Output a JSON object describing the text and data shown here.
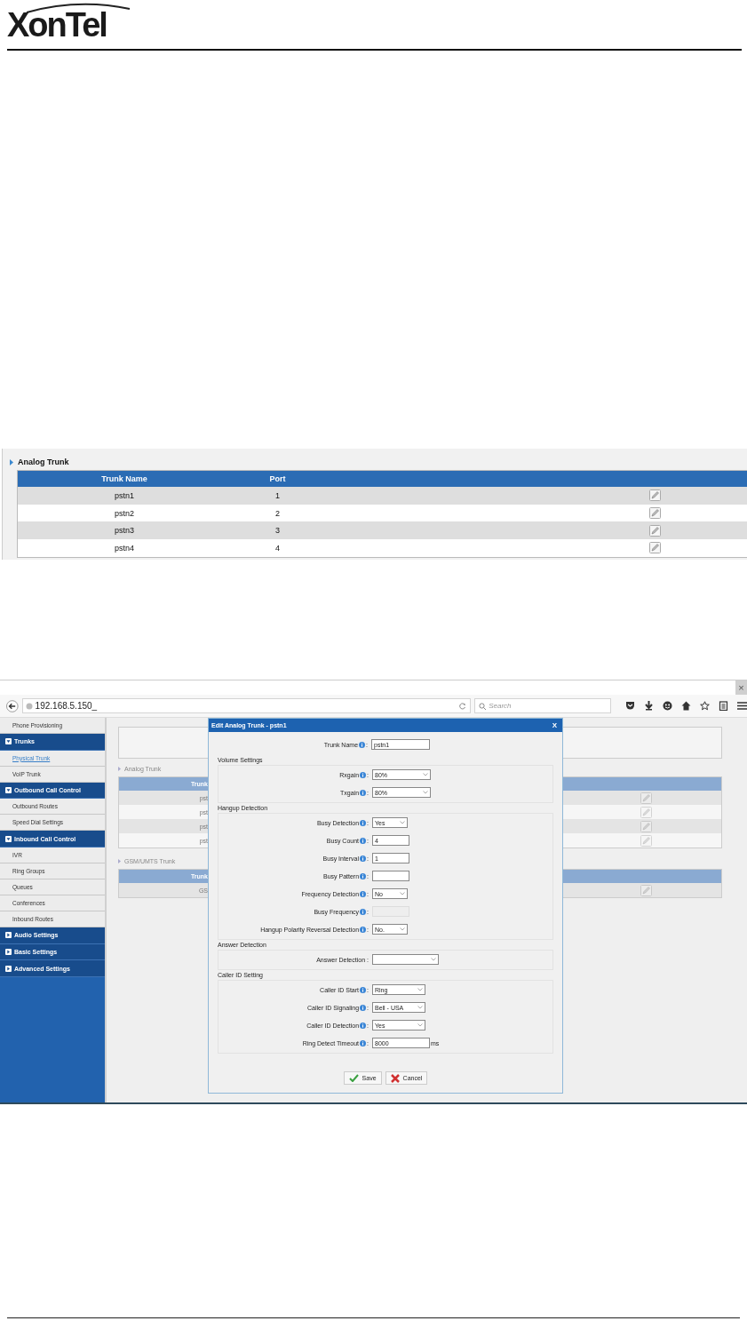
{
  "header": {
    "logo": "XonTel"
  },
  "trunk_table": {
    "title": "Analog Trunk",
    "columns": [
      "Trunk Name",
      "Port"
    ],
    "rows": [
      {
        "cells": [
          "pstn1",
          "1"
        ]
      },
      {
        "cells": [
          "pstn2",
          "2"
        ]
      },
      {
        "cells": [
          "pstn3",
          "3"
        ]
      },
      {
        "cells": [
          "pstn4",
          "4"
        ]
      }
    ]
  },
  "browser": {
    "close": "×",
    "url": "192.168.5.150_",
    "search_placeholder": "Search",
    "sidebar": [
      {
        "kind": "item",
        "label": "Phone Provisioning",
        "selected": false
      },
      {
        "kind": "group",
        "label": "Trunks",
        "expanded": true
      },
      {
        "kind": "item",
        "label": "Physical Trunk",
        "selected": true
      },
      {
        "kind": "item",
        "label": "VoIP Trunk",
        "selected": false
      },
      {
        "kind": "group",
        "label": "Outbound Call Control",
        "expanded": true
      },
      {
        "kind": "item",
        "label": "Outbound Routes",
        "selected": false
      },
      {
        "kind": "item",
        "label": "Speed Dial Settings",
        "selected": false
      },
      {
        "kind": "group",
        "label": "Inbound Call Control",
        "expanded": true
      },
      {
        "kind": "item",
        "label": "IVR",
        "selected": false
      },
      {
        "kind": "item",
        "label": "Ring Groups",
        "selected": false
      },
      {
        "kind": "item",
        "label": "Queues",
        "selected": false
      },
      {
        "kind": "item",
        "label": "Conferences",
        "selected": false
      },
      {
        "kind": "item",
        "label": "Inbound Routes",
        "selected": false
      },
      {
        "kind": "group",
        "label": "Audio Settings",
        "expanded": false
      },
      {
        "kind": "group",
        "label": "Basic Settings",
        "expanded": false
      },
      {
        "kind": "group",
        "label": "Advanced Settings",
        "expanded": false
      }
    ],
    "sections": [
      {
        "title": "Analog Trunk",
        "column": "Trunk",
        "rows": [
          "pst",
          "pst",
          "pst",
          "pst"
        ]
      },
      {
        "title": "GSM/UMTS Trunk",
        "column": "Trunk",
        "rows": [
          "GS"
        ]
      }
    ],
    "dialog": {
      "title": "Edit Analog Trunk - pstn1",
      "close": "X",
      "trunk_name": {
        "label": "Trunk Name",
        "help": true,
        "suffix": ":",
        "kind": "text",
        "value": "pstn1"
      },
      "groups": [
        {
          "legend": "Volume Settings",
          "fields": [
            {
              "label": "Rxgain",
              "help": true,
              "suffix": ":",
              "kind": "select",
              "value": "80%"
            },
            {
              "label": "Txgain",
              "help": true,
              "suffix": ":",
              "kind": "select",
              "value": "80%"
            }
          ]
        },
        {
          "legend": "Hangup Detection",
          "fields": [
            {
              "label": "Busy Detection",
              "help": true,
              "suffix": ":",
              "kind": "select",
              "value": "Yes"
            },
            {
              "label": "Busy Count",
              "help": true,
              "suffix": ":",
              "kind": "text",
              "value": "4"
            },
            {
              "label": "Busy Interval",
              "help": true,
              "suffix": ":",
              "kind": "text",
              "value": "1"
            },
            {
              "label": "Busy Pattern",
              "help": true,
              "suffix": ":",
              "kind": "text"
            },
            {
              "label": "Frequency Detection",
              "help": true,
              "suffix": ":",
              "kind": "select",
              "value": "No"
            },
            {
              "label": "Busy Frequency",
              "help": true,
              "suffix": ":",
              "kind": "text",
              "disabled": true
            },
            {
              "label": "Hangup Polarity Reversal Detection",
              "help": true,
              "suffix": ":",
              "kind": "select",
              "value": "No."
            }
          ]
        },
        {
          "legend": "Answer Detection",
          "fields": [
            {
              "label": "Answer Detection",
              "suffix": ":",
              "kind": "select"
            }
          ]
        },
        {
          "legend": "Caller ID Setting",
          "fields": [
            {
              "label": "Caller ID Start",
              "help": true,
              "suffix": ":",
              "kind": "select",
              "value": "Ring"
            },
            {
              "label": "Caller ID Signaling",
              "help": true,
              "suffix": ":",
              "kind": "select",
              "value": "Bell - USA"
            },
            {
              "label": "Caller ID Detection",
              "help": true,
              "suffix": ":",
              "kind": "select",
              "value": "Yes"
            },
            {
              "label": "Ring Detect Timeout",
              "help": true,
              "suffix": ":",
              "kind": "text",
              "value": "8000",
              "unit": "ms"
            }
          ]
        }
      ],
      "buttons": [
        {
          "kind": "save",
          "label": "Save"
        },
        {
          "kind": "cancel",
          "label": "Cancel"
        }
      ]
    }
  }
}
